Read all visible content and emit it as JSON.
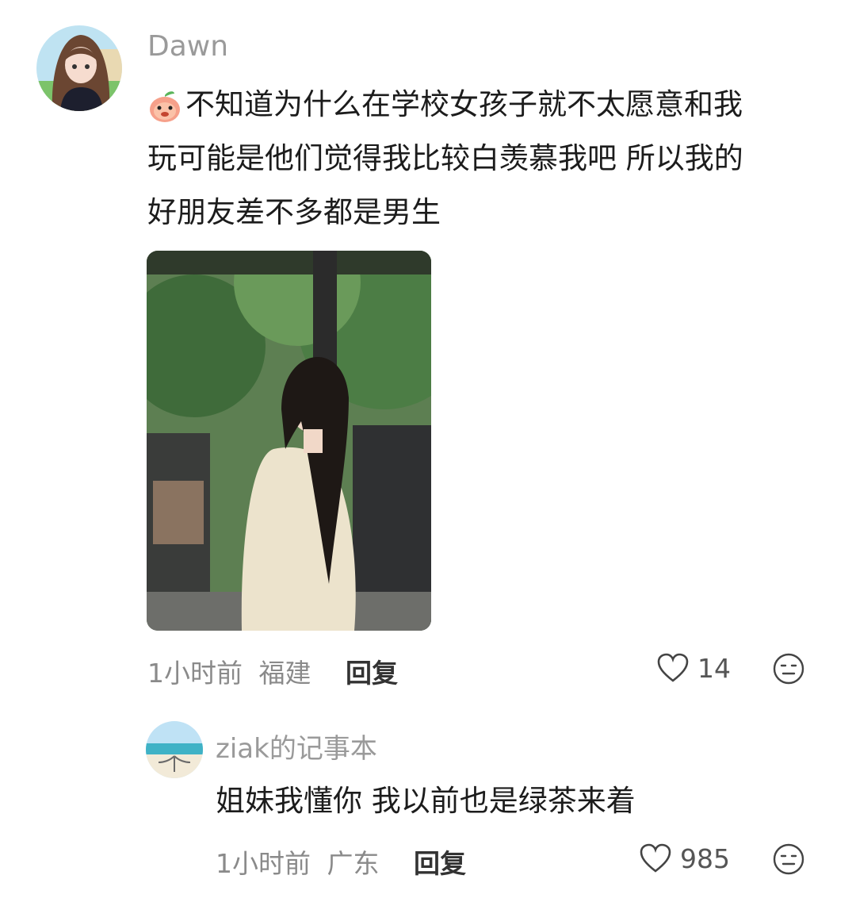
{
  "comment": {
    "username": "Dawn",
    "emoji_icon": "peach-emoji-icon",
    "text_lines": [
      "不知道为什么在学校女孩子就不太愿意和我",
      "玩可能是他们觉得我比较白羡慕我吧 所以我的",
      "好朋友差不多都是男生"
    ],
    "time": "1小时前",
    "location": "福建",
    "reply_label": "回复",
    "likes": "14"
  },
  "reply": {
    "username": "ziak的记事本",
    "text": "姐妹我懂你 我以前也是绿茶来着",
    "time": "1小时前",
    "location": "广东",
    "reply_label": "回复",
    "likes": "985"
  },
  "colors": {
    "meta": "#8a8a8a",
    "username": "#9a9a9a"
  }
}
